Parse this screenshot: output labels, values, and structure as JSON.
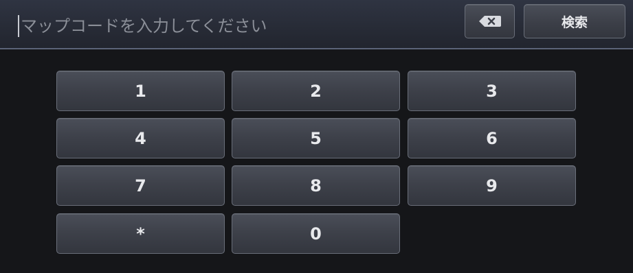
{
  "input": {
    "placeholder": "マップコードを入力してください",
    "value": ""
  },
  "toolbar": {
    "backspace_icon": "backspace-icon",
    "search_label": "検索"
  },
  "keypad": {
    "keys": [
      "1",
      "2",
      "3",
      "4",
      "5",
      "6",
      "7",
      "8",
      "9",
      "*",
      "0"
    ]
  },
  "colors": {
    "background": "#151619",
    "header": "#2b2f3b",
    "header_border": "#5c6478",
    "key_face": "#3d4049",
    "key_text": "#e8e9ec",
    "placeholder_text": "#8b8f98"
  }
}
